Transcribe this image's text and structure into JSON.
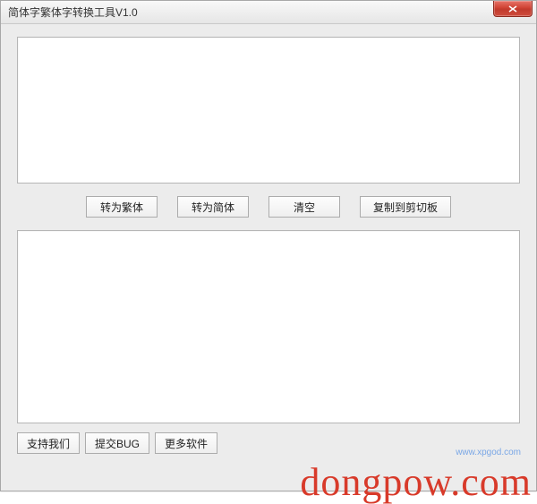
{
  "window": {
    "title": "简体字繁体字转换工具V1.0"
  },
  "input": {
    "value": "",
    "placeholder": ""
  },
  "output": {
    "value": "",
    "placeholder": ""
  },
  "buttons": {
    "to_traditional": "转为繁体",
    "to_simplified": "转为简体",
    "clear": "清空",
    "copy_clipboard": "复制到剪切板"
  },
  "bottom_buttons": {
    "support_us": "支持我们",
    "submit_bug": "提交BUG",
    "more_software": "更多软件"
  },
  "watermark": "dongpow.com",
  "small_link": "www.xpgod.com"
}
